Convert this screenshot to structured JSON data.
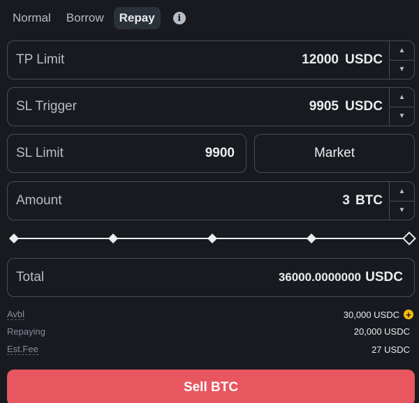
{
  "tabs": [
    {
      "label": "Normal",
      "active": false
    },
    {
      "label": "Borrow",
      "active": false
    },
    {
      "label": "Repay",
      "active": true
    }
  ],
  "info_icon": "info-icon",
  "tp_limit": {
    "label": "TP Limit",
    "value": "12000",
    "unit": "USDC"
  },
  "sl_trigger": {
    "label": "SL Trigger",
    "value": "9905",
    "unit": "USDC"
  },
  "sl_limit": {
    "label": "SL Limit",
    "value": "9900"
  },
  "market_label": "Market",
  "amount": {
    "label": "Amount",
    "value": "3",
    "unit": "BTC"
  },
  "slider": {
    "percent": 100,
    "marks": [
      0,
      25,
      50,
      75,
      100
    ]
  },
  "total": {
    "label": "Total",
    "value": "36000.0000000",
    "unit": "USDC"
  },
  "summary": [
    {
      "key": "Avbl",
      "value": "30,000 USDC"
    },
    {
      "key": "Repaying",
      "value": "20,000 USDC"
    },
    {
      "key": "Est.Fee",
      "value": "27 USDC"
    }
  ],
  "sell_button": "Sell BTC",
  "colors": {
    "sell": "#e8565f",
    "accent": "#f0b90b",
    "background": "#181a20"
  }
}
